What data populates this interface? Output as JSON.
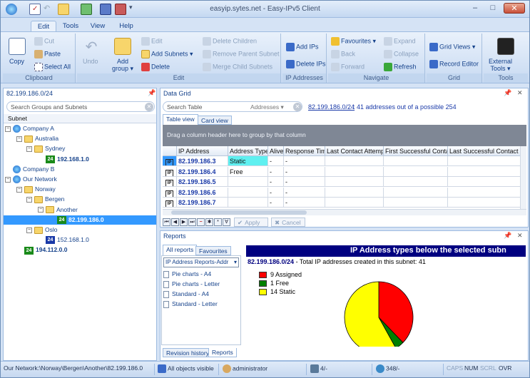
{
  "window": {
    "title": "easyip.sytes.net - Easy-IPv5 Client",
    "min": "–",
    "max": "□",
    "close": "✕"
  },
  "tabs": [
    "Edit",
    "Tools",
    "View",
    "Help"
  ],
  "ribbon": {
    "clipboard": {
      "label": "Clipboard",
      "copy": "Copy",
      "cut": "Cut",
      "paste": "Paste",
      "select_all": "Select All"
    },
    "edit": {
      "label": "Edit",
      "undo": "Undo",
      "add_group": "Add\ngroup",
      "add_group_arrow": "▾",
      "edit": "Edit",
      "add_subnets": "Add Subnets",
      "delete": "Delete",
      "delete_children": "Delete Children",
      "remove_parent": "Remove Parent Subnet",
      "merge_children": "Merge Child Subnets"
    },
    "ip": {
      "label": "IP Addresses",
      "add_ips": "Add IPs",
      "delete_ips": "Delete IPs"
    },
    "navigate": {
      "label": "Navigate",
      "favourites": "Favourites",
      "back": "Back",
      "forward": "Forward",
      "expand": "Expand",
      "collapse": "Collapse",
      "refresh": "Refresh"
    },
    "grid": {
      "label": "Grid",
      "grid_views": "Grid Views",
      "record_editor": "Record Editor"
    },
    "tools": {
      "label": "Tools",
      "external_tools": "External\nTools"
    }
  },
  "left": {
    "header": "82.199.186.0/24",
    "search_placeholder": "Search Groups and Subnets",
    "col": "Subnet",
    "tree": [
      {
        "label": "Company A",
        "type": "globe",
        "exp": "−"
      },
      {
        "label": "Australia",
        "type": "folder",
        "exp": "−"
      },
      {
        "label": "Sydney",
        "type": "folder",
        "exp": "−"
      },
      {
        "label": "192.168.1.0",
        "type": "subnet",
        "badge": "24"
      },
      {
        "label": "Company B",
        "type": "globe",
        "exp": ""
      },
      {
        "label": "Our Network",
        "type": "globe",
        "exp": "−"
      },
      {
        "label": "Norway",
        "type": "folder",
        "exp": "−"
      },
      {
        "label": "Bergen",
        "type": "folder",
        "exp": "−"
      },
      {
        "label": "Another",
        "type": "folder",
        "exp": "−"
      },
      {
        "label": "82.199.186.0",
        "type": "subnet",
        "badge": "24"
      },
      {
        "label": "Oslo",
        "type": "folder",
        "exp": "−"
      },
      {
        "label": "152.168.1.0",
        "type": "subnet",
        "badge": "24"
      },
      {
        "label": "194.112.0.0",
        "type": "subnet",
        "badge": "24"
      }
    ]
  },
  "grid": {
    "header": "Data Grid",
    "search_placeholder": "Search Table",
    "search_scope": "Addresses",
    "subnet_link": "82.199.186.0/24",
    "summary": ": 41 addresses out of a possible 254",
    "tab_table": "Table view",
    "tab_card": "Card view",
    "group_hint": "Drag a column header here to group by that column",
    "columns": [
      "IP Address",
      "Address Type",
      "Alive",
      "Response Time",
      "Last Contact Attempt",
      "First Successful Contact",
      "Last Successful Contact"
    ],
    "rows": [
      {
        "ip": "82.199.186.3",
        "type": "Static",
        "alive": "-",
        "rt": "-"
      },
      {
        "ip": "82.199.186.4",
        "type": "Free",
        "alive": "-",
        "rt": "-"
      },
      {
        "ip": "82.199.186.5",
        "type": "",
        "alive": "-",
        "rt": "-"
      },
      {
        "ip": "82.199.186.6",
        "type": "",
        "alive": "-",
        "rt": "-"
      },
      {
        "ip": "82.199.186.7",
        "type": "",
        "alive": "-",
        "rt": "-"
      }
    ],
    "ip_badge": "IP",
    "apply": "Apply",
    "cancel": "Cancel",
    "nav_buttons": [
      "⏮",
      "◀",
      "▶",
      "⏭",
      "−",
      "✱",
      "*",
      "∀"
    ]
  },
  "reports": {
    "header": "Reports",
    "tab_all": "All reports",
    "tab_fav": "Favourites",
    "dropdown": "IP Address Reports-Addr",
    "items": [
      "Pie charts - A4",
      "Pie charts - Letter",
      "Standard - A4",
      "Standard - Letter"
    ],
    "chart_title": "IP Address types below the selected subn",
    "subnet": "82.199.186.0/24",
    "total_text": " - Total IP addresses created in this subnet: 41",
    "bottom_tabs": [
      "Revision history",
      "Reports"
    ]
  },
  "chart_data": {
    "type": "pie",
    "title": "IP Address types below the selected subn",
    "categories": [
      "Assigned",
      "Free",
      "Static"
    ],
    "values": [
      9,
      1,
      14
    ],
    "legend": [
      "9 Assigned",
      "1 Free",
      "14 Static"
    ],
    "colors": [
      "#ff0000",
      "#008000",
      "#ffff00"
    ],
    "legend_position": "left"
  },
  "status": {
    "path": "Our Network:\\Norway\\Bergen\\Another\\82.199.186.0",
    "objects": "All objects visible",
    "user": "administrator",
    "count1": "4/-",
    "count2": "348/-",
    "caps": "CAPS",
    "num": "NUM",
    "scrl": "SCRL",
    "ovr": "OVR"
  }
}
